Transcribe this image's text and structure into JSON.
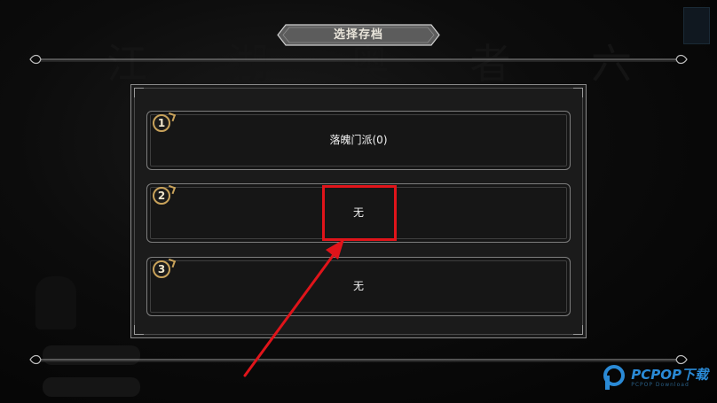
{
  "background": {
    "title_glyphs": [
      "江",
      "湖",
      "奥",
      "者",
      "六"
    ],
    "buttons": [
      "",
      ""
    ]
  },
  "header": {
    "title": "选择存档"
  },
  "save_slots": [
    {
      "number": "1",
      "label": "落魄门派(0)"
    },
    {
      "number": "2",
      "label": "无"
    },
    {
      "number": "3",
      "label": "无"
    }
  ],
  "annotation": {
    "color": "#e0141a",
    "highlighted_slot": "2"
  },
  "watermark": {
    "brand": "PCPOP下载",
    "sub": "PCPOP Download",
    "color": "#2a8ad6"
  },
  "colors": {
    "accent_gold": "#c8a25a",
    "panel_border": "#8a8a8a"
  }
}
